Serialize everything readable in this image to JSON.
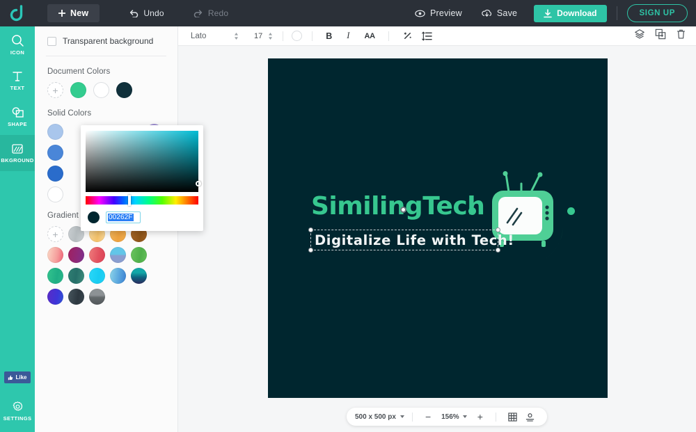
{
  "app": {
    "brand_icon": "design-app-logo-icon",
    "accent": "#2ec4a6",
    "rail_bg": "#2ec7ad",
    "topbar_bg": "#2b3038",
    "canvas_bg": "#00262f"
  },
  "topbar": {
    "new_label": "New",
    "undo_label": "Undo",
    "redo_label": "Redo",
    "preview_label": "Preview",
    "save_label": "Save",
    "download_label": "Download",
    "signup_label": "SIGN UP"
  },
  "rail": {
    "items": [
      {
        "label": "ICON",
        "icon": "search-icon",
        "active": false
      },
      {
        "label": "TEXT",
        "icon": "text-t-icon",
        "active": false
      },
      {
        "label": "SHAPE",
        "icon": "shape-icon",
        "active": false
      },
      {
        "label": "BKGROUND",
        "icon": "background-icon",
        "active": true
      }
    ],
    "like_label": "Like",
    "settings_label": "SETTINGS"
  },
  "panel": {
    "transparent_label": "Transparent background",
    "transparent_checked": false,
    "document_colors_title": "Document Colors",
    "document_colors": [
      "#33cc8f",
      "#ffffff",
      "#10303b"
    ],
    "solid_colors_title": "Solid Colors",
    "solid_colors_left": [
      "#a9c6ec",
      "#4a86d8",
      "#2a6ccb",
      "#ffffff"
    ],
    "solid_colors_right": [
      "#a393d8",
      "#7a4fc4",
      "#5b2fc0",
      "#111111"
    ],
    "gradient_colors_title": "Gradient Colors",
    "gradient_row1": [
      "#c2c9cc",
      "#f6d08a",
      "#f0ab47",
      "#9a5f22",
      "#f4b3a6"
    ],
    "gradient_row2": [
      "#a82a64",
      "#e7636d",
      "#73b5de",
      "#63bf5c",
      "#2dba8d",
      "#2f7f73"
    ],
    "gradient_row3": [
      "#28d4f5",
      "#64b8e8",
      "#0f8fa0",
      "#4435d8",
      "#3f4d56",
      "#6e7376"
    ]
  },
  "edittools": {
    "font_family": "Lato",
    "font_size": "17",
    "bold_label": "B",
    "italic_label": "I",
    "case_label": "AA",
    "effects_icon": "magic-wand-icon",
    "list_icon": "line-spacing-icon",
    "layers_icon": "layers-icon",
    "duplicate_icon": "duplicate-icon",
    "delete_icon": "trash-icon",
    "text_color": "#ffffff"
  },
  "picker": {
    "hex_value": "00262F",
    "swatch_color": "#00262f",
    "hue_color": "#00bcd4"
  },
  "canvas": {
    "logo_title": "SimilingTech",
    "logo_tagline": "Digitalize Life with Tech!",
    "title_color": "#37c78f",
    "tagline_color": "#f2f5f6",
    "graphic_icon": "retro-tv-icon"
  },
  "bottombar": {
    "doc_size": "500 x 500 px",
    "zoom_out_label": "−",
    "zoom_level": "156%",
    "zoom_in_label": "+",
    "grid_icon": "grid-icon",
    "fit_icon": "fit-to-screen-icon"
  }
}
